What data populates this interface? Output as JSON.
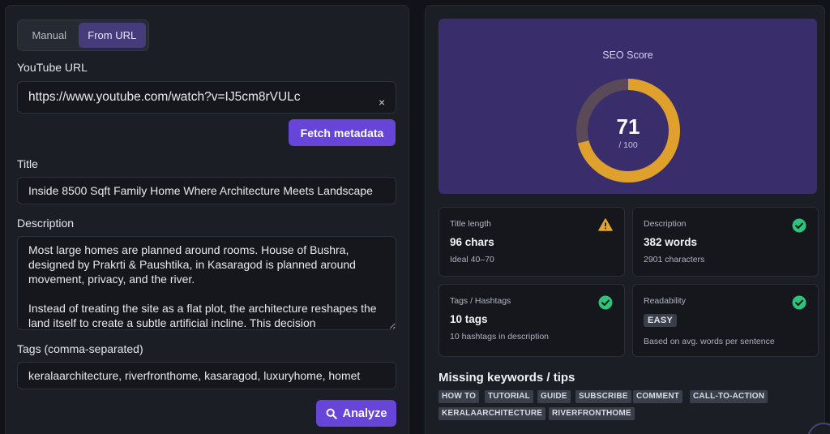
{
  "input": {
    "mode_toggle": {
      "manual": "Manual",
      "from_url": "From URL",
      "active": "from_url"
    },
    "youtube_url": {
      "label": "YouTube URL",
      "value": "https://www.youtube.com/watch?v=IJ5cm8rVULc",
      "clear": "×"
    },
    "fetch_button": "Fetch metadata",
    "title": {
      "label": "Title",
      "value": "Inside 8500 Sqft Family Home Where Architecture Meets Landscape"
    },
    "description": {
      "label": "Description",
      "value": "Most large homes are planned around rooms. House of Bushra, designed by Prakrti & Paushtika, in Kasaragod is planned around movement, privacy, and the river.\n\nInstead of treating the site as a flat plot, the architecture reshapes the land itself to create a subtle artificial incline. This decision"
    },
    "tags": {
      "label": "Tags (comma-separated)",
      "value": "keralaarchitecture, riverfronthome, kasaragod, luxuryhome, homet"
    },
    "analyze_button": "Analyze"
  },
  "results": {
    "seo": {
      "label": "SEO Score",
      "score": "71",
      "max": "/ 100",
      "score_fraction": 0.71
    },
    "metrics": {
      "title_length": {
        "label": "Title length",
        "value": "96 chars",
        "sub": "Ideal 40–70",
        "status": "warning"
      },
      "description": {
        "label": "Description",
        "value": "382 words",
        "sub": "2901 characters",
        "status": "ok"
      },
      "tags": {
        "label": "Tags / Hashtags",
        "value": "10 tags",
        "sub": "10 hashtags in description",
        "status": "ok"
      },
      "readability": {
        "label": "Readability",
        "badge": "EASY",
        "sub": "Based on avg. words per sentence",
        "status": "ok"
      }
    },
    "keywords": {
      "title": "Missing keywords / tips",
      "chips": [
        "HOW TO",
        "TUTORIAL",
        "GUIDE",
        "SUBSCRIBE",
        "COMMENT",
        "CALL-TO-ACTION",
        "KERALAARCHITECTURE",
        "RIVERFRONTHOME"
      ]
    }
  },
  "colors": {
    "accent": "#6645d8",
    "score_arc": "#e0a02c",
    "score_track": "#5a4a58",
    "ok": "#2fc27a",
    "warning": "#e2a52e"
  }
}
